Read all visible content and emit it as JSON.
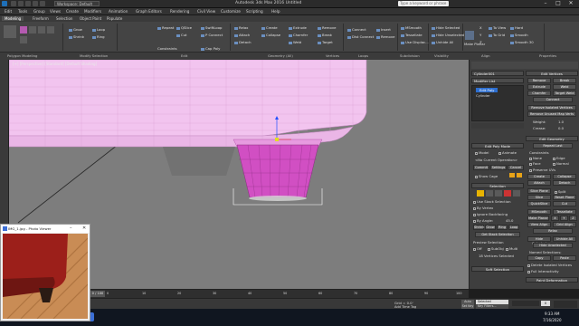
{
  "titlebar": {
    "workspace": "Workspace: Default",
    "app_title": "Autodesk 3ds Max 2016    Untitled",
    "search_placeholder": "Type a keyword or phrase",
    "minimize": "–",
    "maximize": "□",
    "close": "✕"
  },
  "menu": [
    "Edit",
    "Tools",
    "Group",
    "Views",
    "Create",
    "Modifiers",
    "Animation",
    "Graph Editors",
    "Rendering",
    "Civil View",
    "Customize",
    "Scripting",
    "Help"
  ],
  "ribbon_tabs": [
    "Modeling",
    "Freeform",
    "Selection",
    "Object Paint",
    "Populate"
  ],
  "ribbon": {
    "groups": [
      "Polygon Modeling",
      "Modify Selection",
      "Edit",
      "Geometry (All)",
      "Vertices",
      "Loops",
      "Subdivision",
      "Visibility",
      "Align",
      "Properties"
    ],
    "modify": [
      "Grow",
      "Shrink",
      "Loop",
      "Ring"
    ],
    "edit": [
      "Repeat",
      "QSlice",
      "Cut",
      "Constraints",
      "SwiftLoop",
      "P Connect",
      "Cap Poly"
    ],
    "geometry": [
      "Relax",
      "Attach",
      "Detach",
      "Create",
      "Collapse",
      "Chamfer",
      "Weld",
      "Extrude",
      "Remove",
      "Break",
      "Target"
    ],
    "loops": [
      "Connect",
      "Dist Connect",
      "Insert",
      "Remove"
    ],
    "subdivision": [
      "MSmooth",
      "Tessellate",
      "Use Displac..."
    ],
    "visibility": [
      "Hide Selected",
      "Hide Unselected",
      "Unhide All"
    ],
    "align": [
      "Make Planar",
      "To View",
      "To Grid",
      "X",
      "Y",
      "Z"
    ],
    "properties": [
      "Hard",
      "Smooth",
      "Smooth 30"
    ]
  },
  "viewport": {
    "label": "[+] [Perspective] [Standard] [Default Shading]"
  },
  "command_panel": {
    "object_name": "Cylinder001",
    "modifier_list": "Modifier List",
    "stack": [
      "Edit Poly",
      "Cylinder"
    ],
    "edit_poly_mode": "Edit Poly Mode",
    "model": "Model",
    "animate": "Animate",
    "no_current_op": "<No Current Operation>",
    "commit": "Commit",
    "settings": "Settings",
    "cancel": "Cancel",
    "show_cage": "Show Cage",
    "selection": "Selection",
    "use_stack_selection": "Use Stack Selection",
    "by_vertex": "By Vertex",
    "ignore_backfacing": "Ignore Backfacing",
    "by_angle": "By Angle:",
    "angle_value": "45.0",
    "shrink": "Shrink",
    "grow": "Grow",
    "ring": "Ring",
    "loop": "Loop",
    "get_stack_selection": "Get Stack Selection",
    "preview_selection": "Preview Selection",
    "off": "Off",
    "subobj": "SubObj",
    "multi": "Multi",
    "selected_info": "18 Vertices Selected",
    "soft_selection": "Soft Selection",
    "edit_vertices": "Edit Vertices",
    "remove": "Remove",
    "break": "Break",
    "extrude": "Extrude",
    "weld": "Weld",
    "chamfer": "Chamfer",
    "target_weld": "Target Weld",
    "connect": "Connect",
    "remove_isolated": "Remove Isolated Vertices",
    "remove_unused_map": "Remove Unused Map Verts",
    "weight": "Weight:",
    "weight_value": "1.0",
    "crease": "Crease:",
    "crease_value": "0.0",
    "edit_geometry": "Edit Geometry",
    "repeat_last": "Repeat Last",
    "constraints": "Constraints",
    "none": "None",
    "edge": "Edge",
    "face": "Face",
    "normal": "Normal",
    "preserve_uvs": "Preserve UVs",
    "create": "Create",
    "collapse": "Collapse",
    "attach": "Attach",
    "detach": "Detach",
    "slice_plane": "Slice Plane",
    "split": "Split",
    "slice": "Slice",
    "reset_plane": "Reset Plane",
    "quickslice": "QuickSlice",
    "cut": "Cut",
    "msmooth": "MSmooth",
    "tessellate": "Tessellate",
    "make_planar": "Make Planar",
    "x": "X",
    "y": "Y",
    "z": "Z",
    "view_align": "View Align",
    "grid_align": "Grid Align",
    "relax": "Relax",
    "hide_selected": "Hide Selected",
    "unhide_all": "Unhide All",
    "hide_unselected": "Hide Unselected",
    "named_selections": "Named Selections:",
    "copy": "Copy",
    "paste": "Paste",
    "delete_isolated": "Delete Isolated Vertices",
    "full_interactivity": "Full Interactivity",
    "paint_deformation": "Paint Deformation"
  },
  "timeline": {
    "frame_readout": "0 / 100",
    "ticks": [
      "0",
      "10",
      "20",
      "30",
      "40",
      "50",
      "60",
      "70",
      "80",
      "90",
      "100"
    ]
  },
  "status": {
    "grid": "Grid = 0.0'",
    "add_time_tag": "Add Time Tag",
    "auto_key": "Auto Key",
    "selected": "Selected",
    "set_key": "Set Key",
    "key_filters": "Key Filters...",
    "frame": "0"
  },
  "photo_viewer": {
    "title": "IMG_1.jpg - Photo Viewer"
  },
  "taskbar": {
    "time": "9:33 AM",
    "date": "7/16/2020"
  },
  "colors": {
    "mesh": "#f3c6f0",
    "mesh_edge": "#c98cc6",
    "leg": "#d14fc3",
    "viewport_bg": "#7d7d7d"
  }
}
